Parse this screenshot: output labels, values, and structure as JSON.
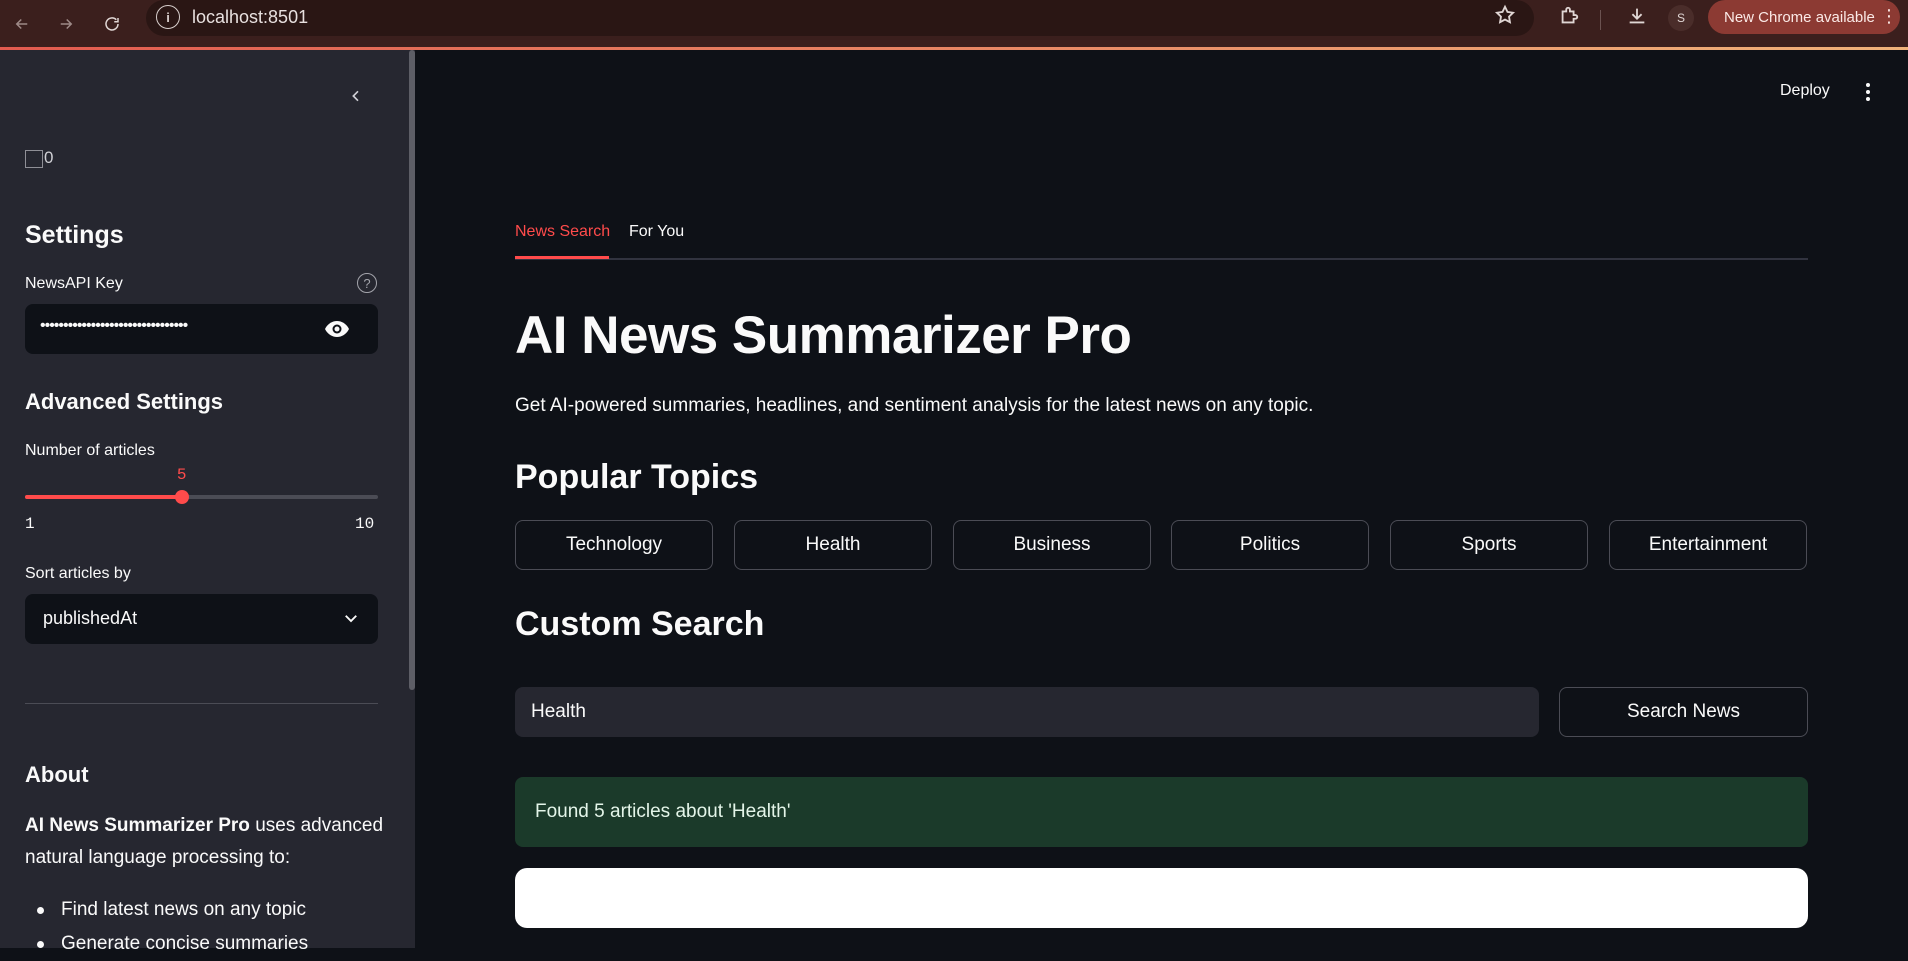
{
  "browser": {
    "url": "localhost:8501",
    "profile_initial": "S",
    "update_label": "New Chrome available"
  },
  "sidebar": {
    "logo_alt": "0",
    "settings_heading": "Settings",
    "api_key": {
      "label": "NewsAPI Key",
      "masked_value": "••••••••••••••••••••••••••••••••"
    },
    "advanced_heading": "Advanced Settings",
    "articles_slider": {
      "label": "Number of articles",
      "value": 5,
      "min": 1,
      "max": 10,
      "value_text": "5",
      "min_text": "1",
      "max_text": "10"
    },
    "sort": {
      "label": "Sort articles by",
      "selected": "publishedAt"
    },
    "about_heading": "About",
    "about_bold": "AI News Summarizer Pro",
    "about_text": " uses advanced natural language processing to:",
    "about_items": [
      "Find latest news on any topic",
      "Generate concise summaries"
    ]
  },
  "header": {
    "deploy_label": "Deploy"
  },
  "tabs": [
    {
      "label": "News Search",
      "active": true
    },
    {
      "label": "For You",
      "active": false
    }
  ],
  "main": {
    "title": "AI News Summarizer Pro",
    "subtitle": "Get AI-powered summaries, headlines, and sentiment analysis for the latest news on any topic.",
    "popular_heading": "Popular Topics",
    "topics": [
      "Technology",
      "Health",
      "Business",
      "Politics",
      "Sports",
      "Entertainment"
    ],
    "custom_heading": "Custom Search",
    "search_value": "Health",
    "search_button": "Search News",
    "result_message": "Found 5 articles about 'Health'"
  },
  "colors": {
    "accent": "#ff4b4b",
    "background": "#0e1117",
    "sidebar": "#262730",
    "success_bg": "#1b3a2a"
  }
}
